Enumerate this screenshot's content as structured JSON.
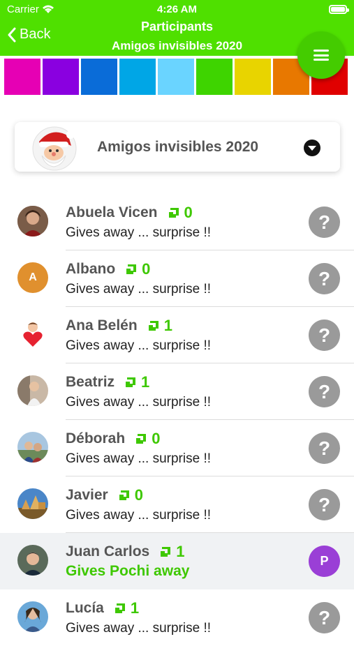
{
  "status_bar": {
    "carrier": "Carrier",
    "time": "4:26 AM"
  },
  "nav": {
    "back_label": "Back",
    "title": "Participants",
    "subtitle": "Amigos invisibles 2020"
  },
  "colors": [
    "#e600b4",
    "#8a00e0",
    "#0a6cd8",
    "#00a6e6",
    "#6ad4ff",
    "#3ed400",
    "#e8d400",
    "#e87800",
    "#e00000"
  ],
  "group": {
    "name": "Amigos invisibles 2020"
  },
  "participants": [
    {
      "name": "Abuela Vicen",
      "count": "0",
      "text": "Gives away ... surprise !!",
      "status": "?"
    },
    {
      "name": "Albano",
      "count": "0",
      "text": "Gives away ... surprise !!",
      "status": "?",
      "initial": "A"
    },
    {
      "name": "Ana Belén",
      "count": "1",
      "text": "Gives away ... surprise !!",
      "status": "?"
    },
    {
      "name": "Beatriz",
      "count": "1",
      "text": "Gives away ... surprise !!",
      "status": "?"
    },
    {
      "name": "Déborah",
      "count": "0",
      "text": "Gives away ... surprise !!",
      "status": "?"
    },
    {
      "name": "Javier",
      "count": "0",
      "text": "Gives away ... surprise !!",
      "status": "?"
    },
    {
      "name": "Juan Carlos",
      "count": "1",
      "text": "Gives Pochi away",
      "status": "P"
    },
    {
      "name": "Lucía",
      "count": "1",
      "text": "Gives away ... surprise !!",
      "status": "?"
    }
  ]
}
